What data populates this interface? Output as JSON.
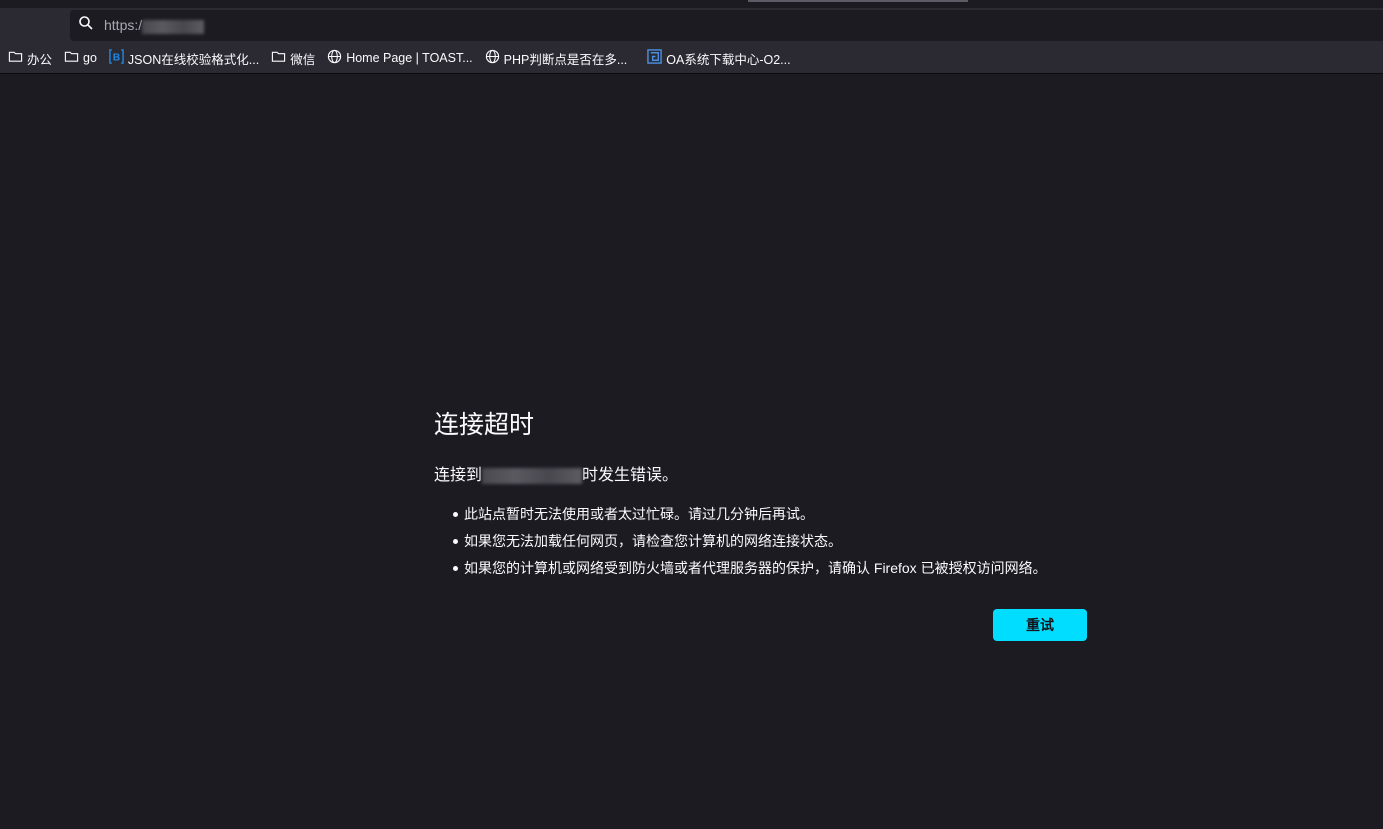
{
  "urlbar": {
    "text": "https:/"
  },
  "bookmarks": [
    {
      "label": "办公",
      "icon": "folder-icon"
    },
    {
      "label": "go",
      "icon": "folder-icon"
    },
    {
      "label": "JSON在线校验格式化...",
      "icon": "bejson-icon"
    },
    {
      "label": "微信",
      "icon": "folder-icon"
    },
    {
      "label": "Home Page | TOAST...",
      "icon": "globe-icon"
    },
    {
      "label": "PHP判断点是否在多...",
      "icon": "globe-icon"
    },
    {
      "label": "OA系统下载中心-O2...",
      "icon": "o2-icon"
    }
  ],
  "error": {
    "title": "连接超时",
    "desc_prefix": "连接到",
    "desc_suffix": "时发生错误。",
    "items": [
      "此站点暂时无法使用或者太过忙碌。请过几分钟后再试。",
      "如果您无法加载任何网页，请检查您计算机的网络连接状态。",
      "如果您的计算机或网络受到防火墙或者代理服务器的保护，请确认 Firefox 已被授权访问网络。"
    ],
    "retry_label": "重试"
  },
  "colors": {
    "accent": "#00ddff",
    "background": "#1c1b22",
    "toolbar": "#2b2a33"
  }
}
